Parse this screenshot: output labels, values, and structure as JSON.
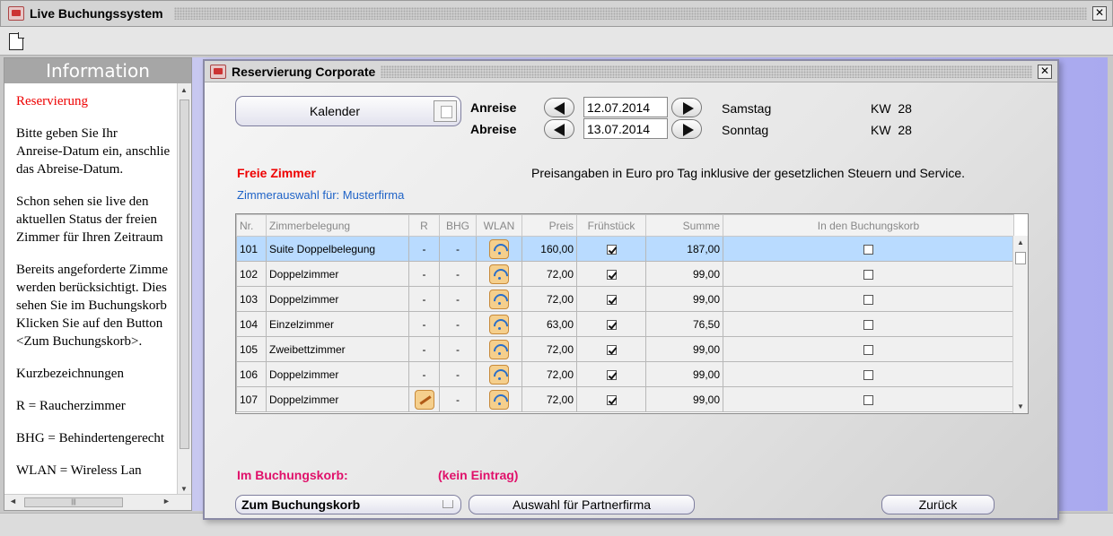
{
  "window": {
    "title": "Live Buchungssystem"
  },
  "info": {
    "header": "Information",
    "lines": [
      "Reservierung",
      "Bitte geben Sie Ihr",
      "Anreise-Datum ein, anschlie",
      "das Abreise-Datum.",
      "Schon sehen sie live den",
      "aktuellen Status der freien",
      "Zimmer für Ihren Zeitraum",
      "Bereits angeforderte Zimme",
      "werden berücksichtigt. Dies",
      "sehen Sie im Buchungskorb",
      "Klicken Sie auf den Button",
      "<Zum Buchungskorb>.",
      "Kurzbezeichnungen",
      "R = Raucherzimmer",
      "BHG = Behindertengerecht",
      "WLAN = Wireless Lan"
    ]
  },
  "dialog": {
    "title": "Reservierung Corporate",
    "calendar_label": "Kalender",
    "arrival_label": "Anreise",
    "departure_label": "Abreise",
    "arrival_date": "12.07.2014",
    "departure_date": "13.07.2014",
    "arrival_day": "Samstag",
    "departure_day": "Sonntag",
    "arrival_week": "KW  28",
    "departure_week": "KW  28",
    "free_rooms_label": "Freie Zimmer",
    "price_note": "Preisangaben in Euro pro Tag inklusive der gesetzlichen Steuern und Service.",
    "selection_label": "Zimmerauswahl für: Musterfirma",
    "basket_label": "Im Buchungskorb:",
    "basket_status": "(kein Eintrag)",
    "basket_button": "Zum Buchungskorb",
    "partner_button": "Auswahl für Partnerfirma",
    "back_button": "Zurück"
  },
  "table": {
    "headers": [
      "Nr.",
      "Zimmerbelegung",
      "R",
      "BHG",
      "WLAN",
      "Preis",
      "Frühstück",
      "Summe",
      "In den Buchungskorb"
    ],
    "rows": [
      {
        "nr": "101",
        "room": "Suite Doppelbelegung",
        "r": "-",
        "bhg": "-",
        "price": "160,00",
        "sum": "187,00",
        "breakfast": true,
        "basket": false,
        "selected": true,
        "smoking": false
      },
      {
        "nr": "102",
        "room": "Doppelzimmer",
        "r": "-",
        "bhg": "-",
        "price": "72,00",
        "sum": "99,00",
        "breakfast": true,
        "basket": false,
        "selected": false,
        "smoking": false
      },
      {
        "nr": "103",
        "room": "Doppelzimmer",
        "r": "-",
        "bhg": "-",
        "price": "72,00",
        "sum": "99,00",
        "breakfast": true,
        "basket": false,
        "selected": false,
        "smoking": false
      },
      {
        "nr": "104",
        "room": "Einzelzimmer",
        "r": "-",
        "bhg": "-",
        "price": "63,00",
        "sum": "76,50",
        "breakfast": true,
        "basket": false,
        "selected": false,
        "smoking": false
      },
      {
        "nr": "105",
        "room": "Zweibettzimmer",
        "r": "-",
        "bhg": "-",
        "price": "72,00",
        "sum": "99,00",
        "breakfast": true,
        "basket": false,
        "selected": false,
        "smoking": false
      },
      {
        "nr": "106",
        "room": "Doppelzimmer",
        "r": "-",
        "bhg": "-",
        "price": "72,00",
        "sum": "99,00",
        "breakfast": true,
        "basket": false,
        "selected": false,
        "smoking": false
      },
      {
        "nr": "107",
        "room": "Doppelzimmer",
        "r": "",
        "bhg": "-",
        "price": "72,00",
        "sum": "99,00",
        "breakfast": true,
        "basket": false,
        "selected": false,
        "smoking": true
      }
    ]
  },
  "colors": {
    "selected_row": "#b9dbff",
    "section_red": "#e00000",
    "basket_pink": "#e0106a",
    "link_blue": "#1f63c7",
    "background_purple": "#a9a9ef"
  },
  "icons": {
    "app": "app-icon",
    "new_document": "new-document-icon",
    "wlan": "wlan-icon",
    "smoking": "smoking-icon",
    "calendar": "calendar-icon",
    "cart": "cart-icon"
  }
}
